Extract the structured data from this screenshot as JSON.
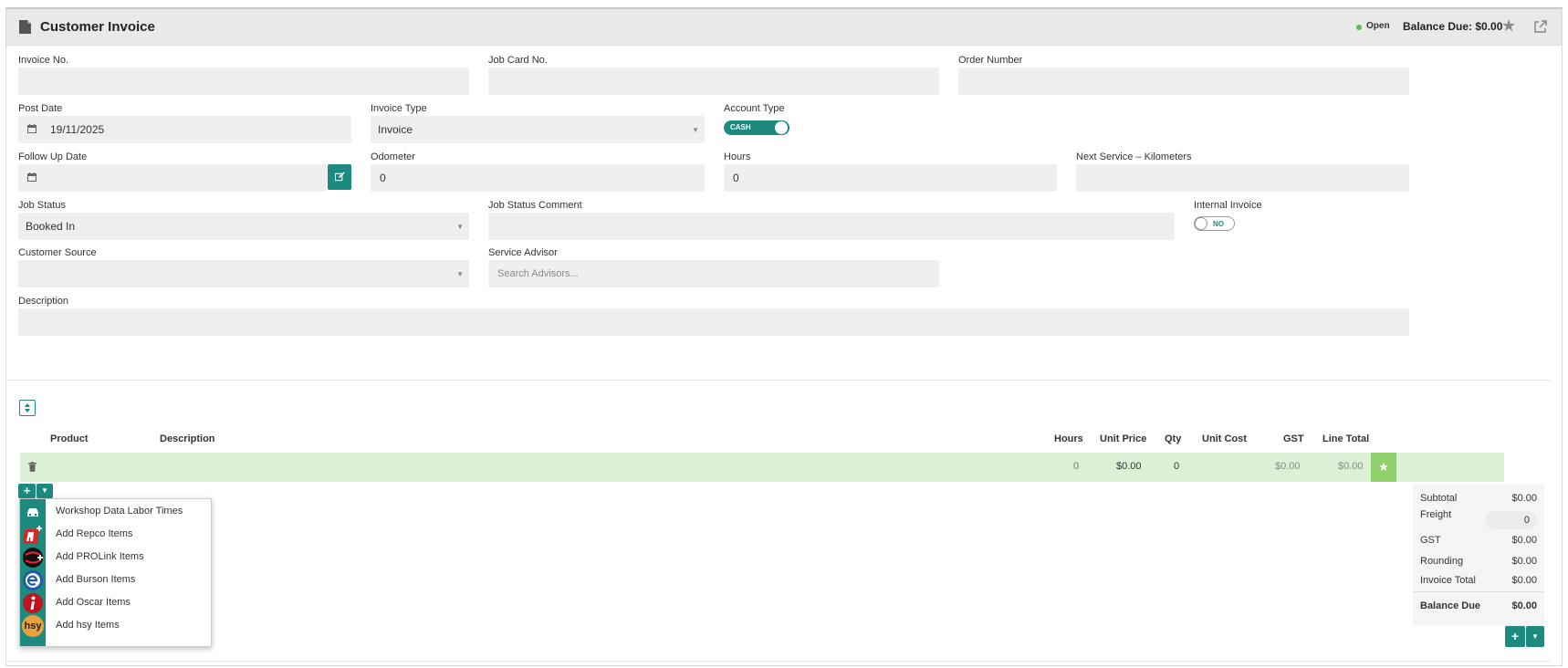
{
  "header": {
    "title": "Customer Invoice",
    "status": "Open",
    "balance": "Balance Due: $0.00"
  },
  "form": {
    "invoice_no": {
      "label": "Invoice No.",
      "value": ""
    },
    "job_card_no": {
      "label": "Job Card No.",
      "value": ""
    },
    "order_number": {
      "label": "Order Number",
      "value": ""
    },
    "post_date": {
      "label": "Post Date",
      "value": "19/11/2025"
    },
    "invoice_type": {
      "label": "Invoice Type",
      "value": "Invoice"
    },
    "account_type": {
      "label": "Account Type",
      "toggle_label": "CASH"
    },
    "follow_up_date": {
      "label": "Follow Up Date",
      "value": ""
    },
    "odometer": {
      "label": "Odometer",
      "value": "0"
    },
    "hours": {
      "label": "Hours",
      "value": "0"
    },
    "next_service_km": {
      "label": "Next Service – Kilometers",
      "value": ""
    },
    "job_status": {
      "label": "Job Status",
      "value": "Booked In"
    },
    "job_status_comment": {
      "label": "Job Status Comment",
      "value": ""
    },
    "internal_invoice": {
      "label": "Internal Invoice",
      "toggle_label": "NO"
    },
    "customer_source": {
      "label": "Customer Source",
      "value": ""
    },
    "service_advisor": {
      "label": "Service Advisor",
      "placeholder": "Search Advisors..."
    },
    "description": {
      "label": "Description",
      "value": ""
    }
  },
  "lines": {
    "columns": [
      "Product",
      "Description",
      "Hours",
      "Unit Price",
      "Qty",
      "Unit Cost",
      "GST",
      "Line Total"
    ],
    "rows": [
      {
        "hours": "0",
        "unit_price": "$0.00",
        "qty": "0",
        "unit_cost": "",
        "gst": "$0.00",
        "line_total": "$0.00"
      }
    ]
  },
  "add_menu": {
    "items": [
      {
        "label": "Workshop Data Labor Times",
        "icon": "car-icon"
      },
      {
        "label": "Add Repco Items",
        "icon": "repco-logo-icon"
      },
      {
        "label": "Add PROLink Items",
        "icon": "prolink-logo-icon"
      },
      {
        "label": "Add Burson Items",
        "icon": "burson-logo-icon"
      },
      {
        "label": "Add Oscar Items",
        "icon": "oscar-logo-icon"
      },
      {
        "label": "Add hsy Items",
        "icon": "hsy-logo-icon",
        "logo_text": "hsy"
      }
    ]
  },
  "totals": {
    "subtotal": {
      "label": "Subtotal",
      "value": "$0.00"
    },
    "freight": {
      "label": "Freight",
      "value": "0"
    },
    "gst": {
      "label": "GST",
      "value": "$0.00"
    },
    "rounding": {
      "label": "Rounding",
      "value": "$0.00"
    },
    "invoice_total": {
      "label": "Invoice Total",
      "value": "$0.00"
    },
    "balance_due": {
      "label": "Balance Due",
      "value": "$0.00"
    }
  },
  "colors": {
    "accent": "#1c8a7e",
    "row_highlight": "#dbf0d4",
    "star_button": "#8fd06b"
  }
}
